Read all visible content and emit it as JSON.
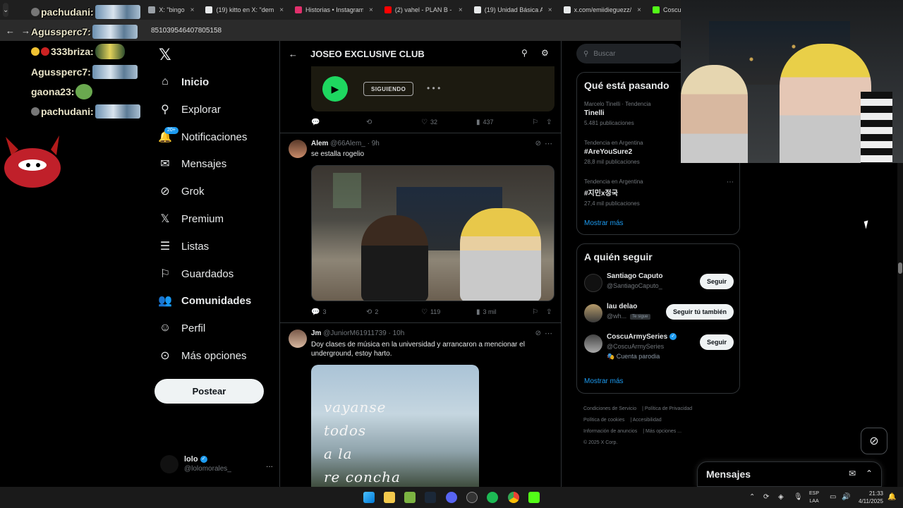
{
  "browser": {
    "tabs": [
      {
        "label": "X: \"bingo",
        "color": "#9aa0a6"
      },
      {
        "label": "(19) kitto en X: \"dem",
        "color": "#e7e9ea"
      },
      {
        "label": "Historias • Instagram",
        "color": "#e1306c"
      },
      {
        "label": "(2) vahel - PLAN B - Y",
        "color": "#ff0000"
      },
      {
        "label": "(19) Unidad Básica A",
        "color": "#e7e9ea"
      },
      {
        "label": "x.com/emiidieguezz/",
        "color": "#e7e9ea"
      },
      {
        "label": "Coscu Stream -",
        "color": "#53fc18"
      }
    ],
    "url": "851039546407805158"
  },
  "stream_chat": [
    {
      "user": "pachudani:",
      "emote": "car"
    },
    {
      "user": "Agussperc7:",
      "emote": "car"
    },
    {
      "user": "333briza:",
      "emote": "minion"
    },
    {
      "user": "Agussperc7:",
      "emote": "car"
    },
    {
      "user": "gaona23:",
      "emote": "pepe"
    },
    {
      "user": "pachudani:",
      "emote": "car"
    }
  ],
  "nav": {
    "items": [
      {
        "label": "Inicio",
        "icon": "home-icon"
      },
      {
        "label": "Explorar",
        "icon": "search-icon"
      },
      {
        "label": "Notificaciones",
        "icon": "bell-icon",
        "badge": "20+"
      },
      {
        "label": "Mensajes",
        "icon": "mail-icon"
      },
      {
        "label": "Grok",
        "icon": "grok-icon"
      },
      {
        "label": "Premium",
        "icon": "x-icon"
      },
      {
        "label": "Listas",
        "icon": "list-icon"
      },
      {
        "label": "Guardados",
        "icon": "bookmark-icon"
      },
      {
        "label": "Comunidades",
        "icon": "communities-icon"
      },
      {
        "label": "Perfil",
        "icon": "person-icon"
      },
      {
        "label": "Más opciones",
        "icon": "more-circle-icon"
      }
    ],
    "post_label": "Postear",
    "profile": {
      "name": "lolo",
      "handle": "@lolomorales_",
      "more": "..."
    }
  },
  "feed": {
    "title": "JOSEO EXCLUSIVE CLUB",
    "card": {
      "following_label": "SIGUIENDO",
      "dots": "• • •"
    },
    "first_actions": {
      "replies": "",
      "reposts": "",
      "likes": "32",
      "views": "437"
    },
    "tweets": [
      {
        "name": "Alem",
        "handle": "@66Alem_",
        "time": "· 9h",
        "text": "se estalla rogelio",
        "actions": {
          "replies": "3",
          "reposts": "2",
          "likes": "119",
          "views": "3 mil"
        }
      },
      {
        "name": "Jm",
        "handle": "@JuniorM61911739",
        "time": "· 10h",
        "text": "Doy clases de música en la universidad y arrancaron a mencionar el underground, estoy harto.",
        "image_lines": [
          "vayanse",
          "todos",
          "a la",
          "re concha"
        ]
      }
    ]
  },
  "sidebar": {
    "search_placeholder": "Buscar",
    "trends_title": "Qué está pasando",
    "trends": [
      {
        "meta": "Marcelo Tinelli · Tendencia",
        "topic": "Tinelli",
        "count": "5.481 publicaciones"
      },
      {
        "meta": "Tendencia en Argentina",
        "topic": "#AreYouSure2",
        "count": "28,8 mil publicaciones"
      },
      {
        "meta": "Tendencia en Argentina",
        "topic": "#지민x정국",
        "count": "27,4 mil publicaciones"
      }
    ],
    "show_more": "Mostrar más",
    "follow_title": "A quién seguir",
    "follows": [
      {
        "name": "Santiago Caputo",
        "handle": "@SantiagoCaputo_",
        "button": "Seguir",
        "note": "",
        "follows_you": ""
      },
      {
        "name": "lau delao",
        "handle": "@wh...",
        "button": "Seguir tú también",
        "note": "",
        "follows_you": "Te sigue"
      },
      {
        "name": "CoscuArmySeries",
        "handle": "@CoscuArmySeries",
        "button": "Seguir",
        "note": "🎭 Cuenta parodia",
        "follows_you": ""
      }
    ],
    "show_more_2": "Mostrar más",
    "footer": [
      "Condiciones de Servicio",
      "Política de Privacidad",
      "Política de cookies",
      "Accesibilidad",
      "Información de anuncios",
      "Más opciones ...",
      "© 2025 X Corp."
    ]
  },
  "messages_drawer": {
    "title": "Mensajes"
  },
  "taskbar": {
    "lang": [
      "ESP",
      "LAA"
    ],
    "time": "21:33",
    "date": "4/11/2025"
  }
}
